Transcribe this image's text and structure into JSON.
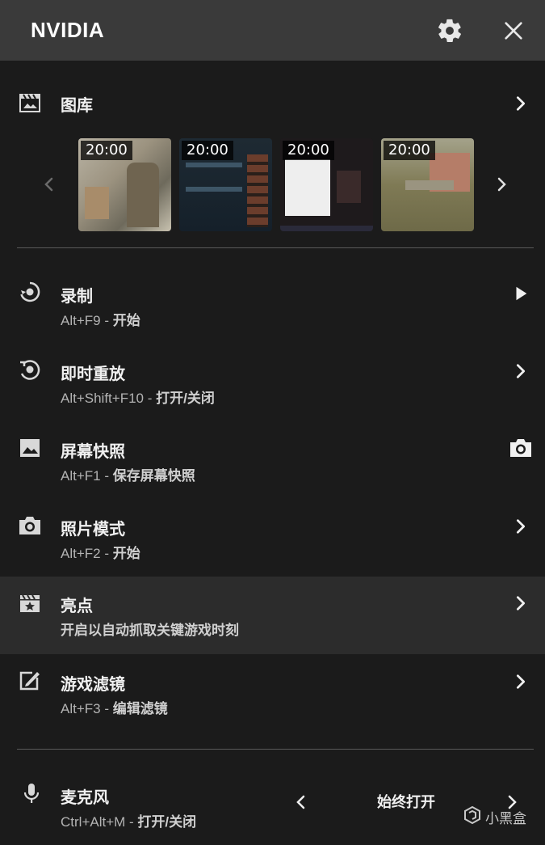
{
  "header": {
    "title": "NVIDIA"
  },
  "gallery": {
    "label": "图库",
    "thumbnails": [
      {
        "time": "20:00"
      },
      {
        "time": "20:00"
      },
      {
        "time": "20:00"
      },
      {
        "time": "20:00"
      }
    ]
  },
  "items": [
    {
      "label": "录制",
      "shortcut": "Alt+F9 - ",
      "action": "开始"
    },
    {
      "label": "即时重放",
      "shortcut": "Alt+Shift+F10 - ",
      "action": "打开/关闭"
    },
    {
      "label": "屏幕快照",
      "shortcut": "Alt+F1 - ",
      "action": "保存屏幕快照"
    },
    {
      "label": "照片模式",
      "shortcut": "Alt+F2 - ",
      "action": "开始"
    },
    {
      "label": "亮点",
      "shortcut": "",
      "action": "开启以自动抓取关键游戏时刻"
    },
    {
      "label": "游戏滤镜",
      "shortcut": "Alt+F3 - ",
      "action": "编辑滤镜"
    }
  ],
  "microphone": {
    "label": "麦克风",
    "shortcut": "Ctrl+Alt+M - ",
    "action": "打开/关闭",
    "mode": "始终打开"
  },
  "watermark": "小黑盒"
}
